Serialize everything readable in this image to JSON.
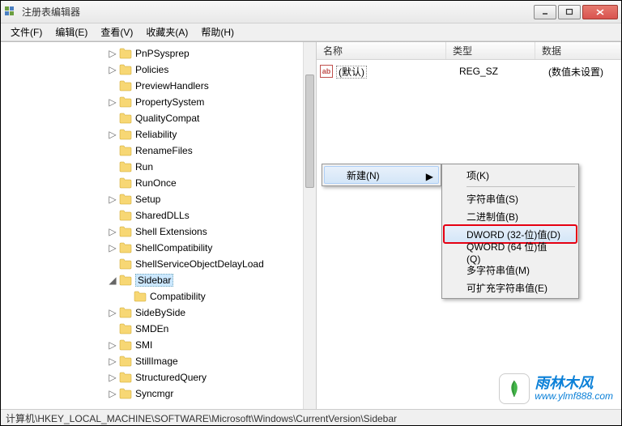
{
  "window": {
    "title": "注册表编辑器"
  },
  "menu": {
    "file": "文件(F)",
    "edit": "编辑(E)",
    "view": "查看(V)",
    "favorites": "收藏夹(A)",
    "help": "帮助(H)"
  },
  "tree": {
    "items": [
      {
        "label": "PnPSysprep",
        "expander": "▷",
        "indent": 0
      },
      {
        "label": "Policies",
        "expander": "▷",
        "indent": 0
      },
      {
        "label": "PreviewHandlers",
        "expander": "",
        "indent": 0
      },
      {
        "label": "PropertySystem",
        "expander": "▷",
        "indent": 0
      },
      {
        "label": "QualityCompat",
        "expander": "",
        "indent": 0
      },
      {
        "label": "Reliability",
        "expander": "▷",
        "indent": 0
      },
      {
        "label": "RenameFiles",
        "expander": "",
        "indent": 0
      },
      {
        "label": "Run",
        "expander": "",
        "indent": 0
      },
      {
        "label": "RunOnce",
        "expander": "",
        "indent": 0
      },
      {
        "label": "Setup",
        "expander": "▷",
        "indent": 0
      },
      {
        "label": "SharedDLLs",
        "expander": "",
        "indent": 0
      },
      {
        "label": "Shell Extensions",
        "expander": "▷",
        "indent": 0
      },
      {
        "label": "ShellCompatibility",
        "expander": "▷",
        "indent": 0
      },
      {
        "label": "ShellServiceObjectDelayLoad",
        "expander": "",
        "indent": 0
      },
      {
        "label": "Sidebar",
        "expander": "◢",
        "indent": 0,
        "selected": true
      },
      {
        "label": "Compatibility",
        "expander": "",
        "indent": 1
      },
      {
        "label": "SideBySide",
        "expander": "▷",
        "indent": 0
      },
      {
        "label": "SMDEn",
        "expander": "",
        "indent": 0
      },
      {
        "label": "SMI",
        "expander": "▷",
        "indent": 0
      },
      {
        "label": "StillImage",
        "expander": "▷",
        "indent": 0
      },
      {
        "label": "StructuredQuery",
        "expander": "▷",
        "indent": 0
      },
      {
        "label": "Syncmgr",
        "expander": "▷",
        "indent": 0
      }
    ]
  },
  "list": {
    "headers": {
      "name": "名称",
      "type": "类型",
      "data": "数据"
    },
    "rows": [
      {
        "icon": "ab",
        "name": "(默认)",
        "type": "REG_SZ",
        "data": "(数值未设置)"
      }
    ]
  },
  "context": {
    "new": "新建(N)",
    "sub": {
      "key": "项(K)",
      "string": "字符串值(S)",
      "binary": "二进制值(B)",
      "dword": "DWORD (32-位)值(D)",
      "qword": "QWORD (64 位)值(Q)",
      "multi": "多字符串值(M)",
      "expandable": "可扩充字符串值(E)"
    }
  },
  "statusbar": "计算机\\HKEY_LOCAL_MACHINE\\SOFTWARE\\Microsoft\\Windows\\CurrentVersion\\Sidebar",
  "watermark": {
    "brand": "雨林木风",
    "url": "www.ylmf888.com"
  }
}
